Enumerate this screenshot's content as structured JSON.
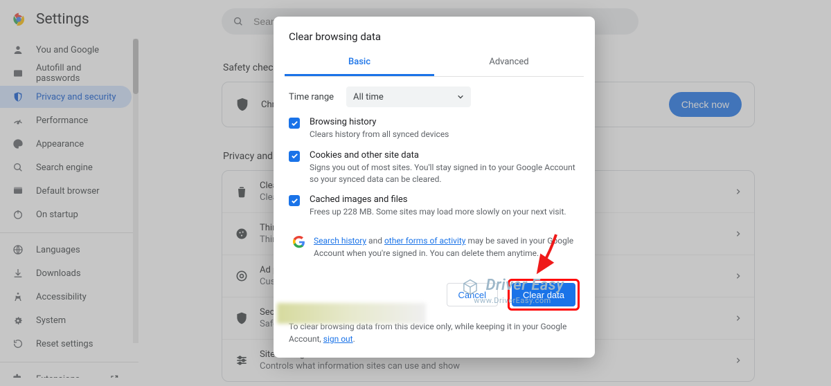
{
  "header": {
    "title": "Settings"
  },
  "search": {
    "placeholder": "Search settings"
  },
  "sidebar": [
    {
      "key": "you",
      "label": "You and Google"
    },
    {
      "key": "autofill",
      "label": "Autofill and passwords"
    },
    {
      "key": "privacy",
      "label": "Privacy and security",
      "active": true
    },
    {
      "key": "performance",
      "label": "Performance"
    },
    {
      "key": "appearance",
      "label": "Appearance"
    },
    {
      "key": "search",
      "label": "Search engine"
    },
    {
      "key": "default",
      "label": "Default browser"
    },
    {
      "key": "startup",
      "label": "On startup"
    },
    {
      "key": "languages",
      "label": "Languages"
    },
    {
      "key": "downloads",
      "label": "Downloads"
    },
    {
      "key": "a11y",
      "label": "Accessibility"
    },
    {
      "key": "system",
      "label": "System"
    },
    {
      "key": "reset",
      "label": "Reset settings"
    },
    {
      "key": "extensions",
      "label": "Extensions"
    }
  ],
  "main": {
    "safety_heading": "Safety check",
    "safety_text": "Chrome can help keep you safe",
    "check_now": "Check now",
    "privacy_heading": "Privacy and security",
    "rows": [
      {
        "icon": "trash",
        "title": "Clear browsing data",
        "desc": "Clear history, cookies, cache, and more"
      },
      {
        "icon": "cookie",
        "title": "Third-party cookies",
        "desc": "Third-party cookies are blocked in Incognito mode"
      },
      {
        "icon": "ads",
        "title": "Ad privacy",
        "desc": "Customize the info used by sites to show you ads"
      },
      {
        "icon": "shield",
        "title": "Security",
        "desc": "Safe Browsing (protection) and other security settings"
      },
      {
        "icon": "sliders",
        "title": "Site settings",
        "desc": "Controls what information sites can use and show"
      }
    ]
  },
  "dialog": {
    "title": "Clear browsing data",
    "tabs": {
      "basic": "Basic",
      "advanced": "Advanced"
    },
    "time_range_label": "Time range",
    "time_range_value": "All time",
    "checks": [
      {
        "title": "Browsing history",
        "desc": "Clears history from all synced devices"
      },
      {
        "title": "Cookies and other site data",
        "desc": "Signs you out of most sites. You'll stay signed in to your Google Account so your synced data can be cleared."
      },
      {
        "title": "Cached images and files",
        "desc": "Frees up 228 MB. Some sites may load more slowly on your next visit."
      }
    ],
    "google_note": {
      "link1": "Search history",
      "mid": " and ",
      "link2": "other forms of activity",
      "tail": " may be saved in your Google Account when you're signed in. You can delete them anytime."
    },
    "cancel": "Cancel",
    "clear": "Clear data",
    "footnote_pre": "To clear browsing data from this device only, while keeping it in your Google Account, ",
    "footnote_link": "sign out",
    "footnote_post": "."
  },
  "watermark": {
    "line1": "Driver Easy",
    "line2": "www.DriverEasy.com"
  }
}
